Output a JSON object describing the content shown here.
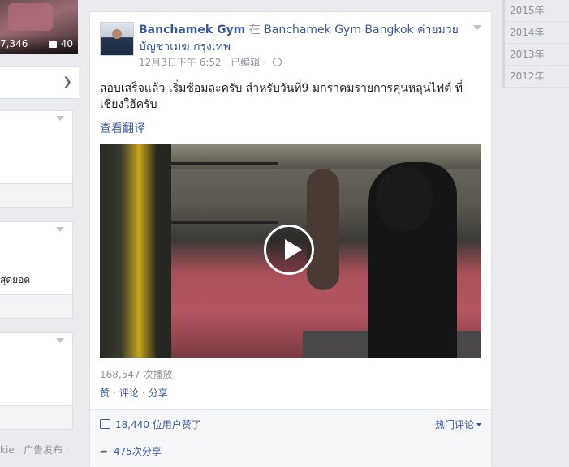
{
  "left": {
    "thumb_views": "7,346",
    "thumb_comments": "40",
    "card2_text": "สุดยอด",
    "footer_links": "kie · 广告发布 ·"
  },
  "post": {
    "page_name": "Banchamek Gym",
    "in_word": "在",
    "location": "Banchamek Gym Bangkok ค่ายมวยบัญชาเมฆ กรุงเทพ",
    "timestamp": "12月3日下午 6:52",
    "edited": "已编辑",
    "message": "สอบเสร็จแล้ว เริ่มซ้อมละครับ สำหรับวันที่9 มกราคมรายการคุนหลุนไฟต์ ที่เชียงใฮ้ครับ",
    "see_translation": "查看翻译",
    "plays": "168,547 次播放",
    "actions": {
      "like": "赞",
      "comment": "评论",
      "share": "分享"
    },
    "likes": "18,440 位用户赞了",
    "hot_comments": "热门评论",
    "shares": "475次分享"
  },
  "years": [
    "2015年",
    "2014年",
    "2013年",
    "2012年"
  ],
  "colors": {
    "link": "#385898",
    "muted": "#90949c",
    "bg": "#e9ebee"
  }
}
